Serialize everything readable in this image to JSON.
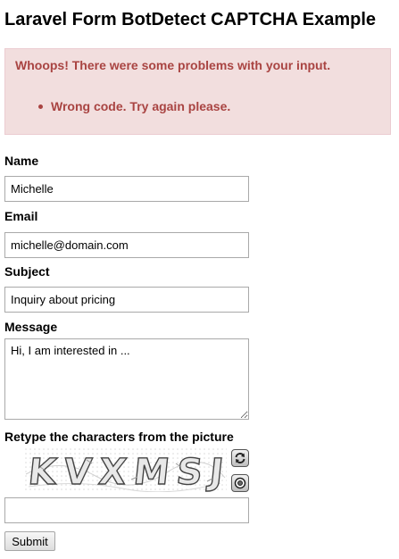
{
  "title": "Laravel Form BotDetect CAPTCHA Example",
  "errors": {
    "heading": "Whoops! There were some problems with your input.",
    "items": [
      "Wrong code. Try again please."
    ]
  },
  "form": {
    "name_label": "Name",
    "name_value": "Michelle",
    "email_label": "Email",
    "email_value": "michelle@domain.com",
    "subject_label": "Subject",
    "subject_value": "Inquiry about pricing",
    "message_label": "Message",
    "message_value": "Hi, I am interested in ...",
    "captcha_label": "Retype the characters from the picture",
    "captcha_code": "KVXMSJ",
    "captcha_value": "",
    "submit_label": "Submit"
  },
  "icons": {
    "reload": "reload-icon",
    "sound": "speaker-icon"
  },
  "colors": {
    "error_background": "#f2dede",
    "error_border": "#ebccd1",
    "error_text": "#a94442"
  }
}
